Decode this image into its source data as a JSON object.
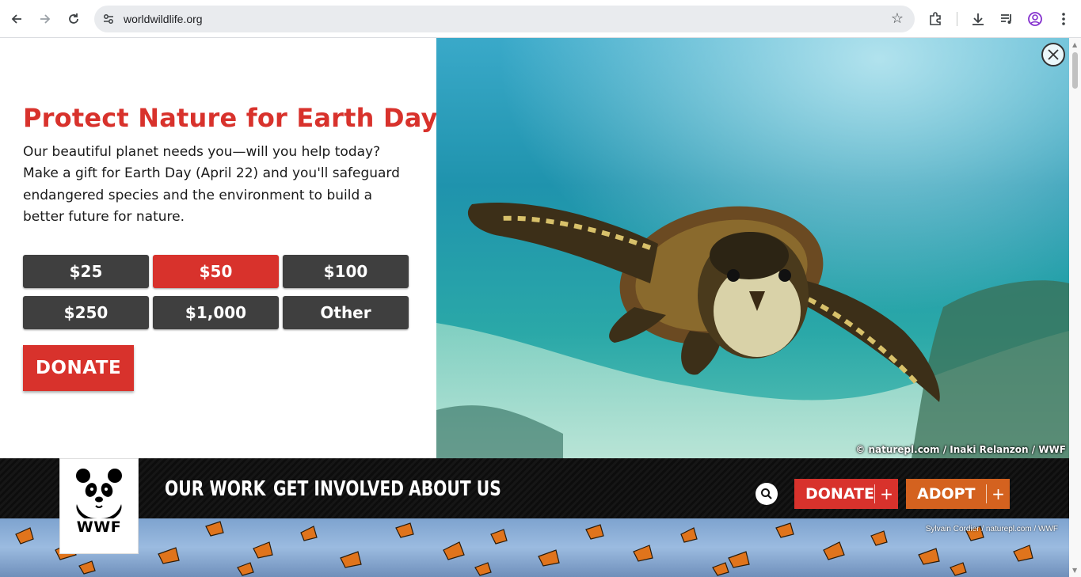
{
  "browser": {
    "url": "worldwildlife.org",
    "icons": [
      "back-icon",
      "forward-icon",
      "reload-icon",
      "site-settings-icon",
      "bookmark-star-icon",
      "extensions-icon",
      "download-icon",
      "media-controls-icon",
      "profile-icon",
      "menu-icon"
    ]
  },
  "modal": {
    "headline": "Protect Nature for Earth Day",
    "body": "Our beautiful planet needs you—will you help today? Make a gift for Earth Day (April 22) and you'll safeguard endangered species and the environment to build a better future for nature.",
    "amounts": [
      {
        "label": "$25",
        "selected": false
      },
      {
        "label": "$50",
        "selected": true
      },
      {
        "label": "$100",
        "selected": false
      },
      {
        "label": "$250",
        "selected": false
      },
      {
        "label": "$1,000",
        "selected": false
      },
      {
        "label": "Other",
        "selected": false
      }
    ],
    "donate_label": "DONATE",
    "image_credit": "© naturepl.com / Inaki Relanzon / WWF"
  },
  "site_nav": {
    "logo_text": "WWF",
    "links": [
      "OUR WORK",
      "GET INVOLVED",
      "ABOUT US"
    ],
    "donate_label": "DONATE",
    "adopt_label": "ADOPT",
    "plus": "+"
  },
  "banner": {
    "credit": "Sylvain Cordier / naturepl.com / WWF"
  },
  "colors": {
    "accent_red": "#d8322c",
    "amount_dark": "#3f3f3f",
    "adopt_orange": "#d4621f"
  }
}
